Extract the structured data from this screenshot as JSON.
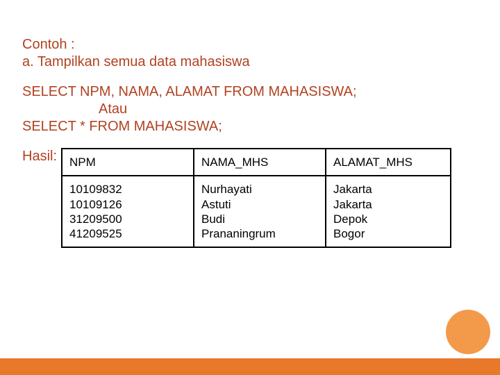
{
  "intro": "Contoh :",
  "list_item": "a.  Tampilkan semua data mahasiswa",
  "sql": {
    "line1": "SELECT NPM, NAMA, ALAMAT FROM MAHASISWA;",
    "or": "Atau",
    "line2": "SELECT * FROM MAHASISWA;"
  },
  "result_label": "Hasil:",
  "table": {
    "headers": [
      "NPM",
      "NAMA_MHS",
      "ALAMAT_MHS"
    ],
    "npm": [
      "10109832",
      "10109126",
      "31209500",
      "41209525"
    ],
    "nama": [
      "Nurhayati",
      "Astuti",
      "Budi",
      "Prananingrum"
    ],
    "alamat": [
      "Jakarta",
      "Jakarta",
      "Depok",
      "Bogor"
    ]
  },
  "colors": {
    "text": "#b04221",
    "circle": "#f39a4a",
    "bar": "#e8792a"
  }
}
